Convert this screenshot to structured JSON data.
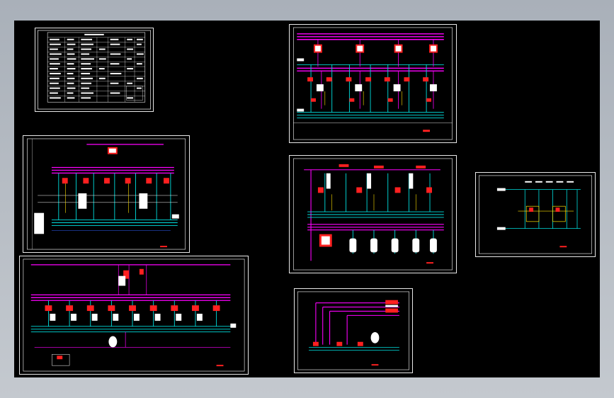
{
  "viewer": {
    "background": "#000000",
    "border_color": "#e8e8e8",
    "colors": {
      "magenta": "#ff00ff",
      "cyan": "#00e0e0",
      "red": "#ff2020",
      "white": "#ffffff",
      "yellow": "#ffe000",
      "green": "#30ff30",
      "blue": "#3060ff"
    }
  },
  "sheets": [
    {
      "id": "legend-table"
    },
    {
      "id": "system-diagram-a"
    },
    {
      "id": "system-diagram-b"
    },
    {
      "id": "system-diagram-c"
    },
    {
      "id": "system-diagram-d"
    },
    {
      "id": "system-diagram-e"
    },
    {
      "id": "system-diagram-f"
    }
  ]
}
